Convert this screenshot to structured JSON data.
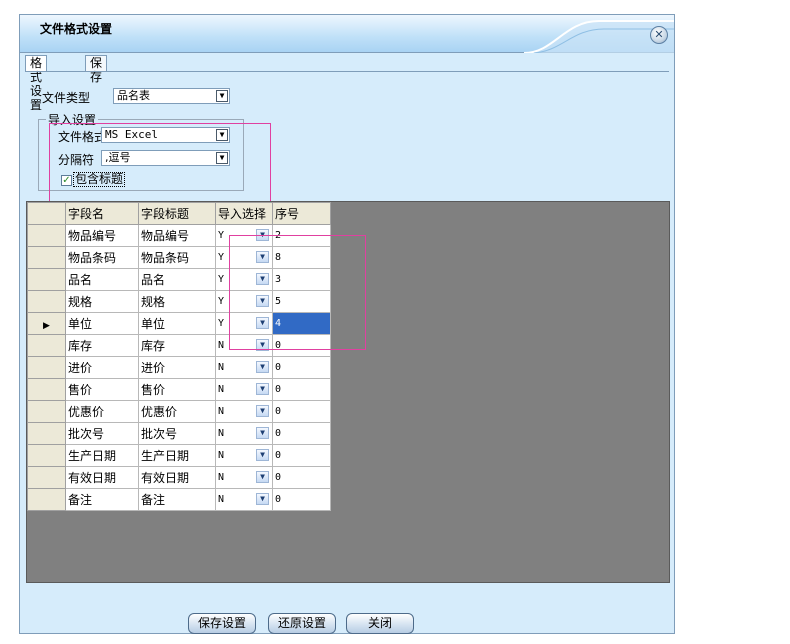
{
  "window": {
    "title": "文件格式设置"
  },
  "tabs": [
    {
      "label": "格式设置",
      "active": true
    },
    {
      "label": "保存",
      "active": false
    }
  ],
  "form": {
    "file_type_label": "文件类型",
    "file_type_value": "品名表",
    "import_group_legend": "导入设置",
    "file_format_label": "文件格式",
    "file_format_value": "MS Excel",
    "separator_label": "分隔符",
    "separator_value": ",逗号",
    "include_header_label": "包含标题",
    "include_header_checked": true
  },
  "grid": {
    "columns": [
      "字段名",
      "字段标题",
      "导入选择",
      "序号"
    ],
    "current_row_index": 4,
    "rows": [
      {
        "name": "物品编号",
        "title": "物品编号",
        "import": "Y",
        "seq": "2"
      },
      {
        "name": "物品条码",
        "title": "物品条码",
        "import": "Y",
        "seq": "8"
      },
      {
        "name": "品名",
        "title": "品名",
        "import": "Y",
        "seq": "3"
      },
      {
        "name": "规格",
        "title": "规格",
        "import": "Y",
        "seq": "5"
      },
      {
        "name": "单位",
        "title": "单位",
        "import": "Y",
        "seq": "4"
      },
      {
        "name": "库存",
        "title": "库存",
        "import": "N",
        "seq": "0"
      },
      {
        "name": "进价",
        "title": "进价",
        "import": "N",
        "seq": "0"
      },
      {
        "name": "售价",
        "title": "售价",
        "import": "N",
        "seq": "0"
      },
      {
        "name": "优惠价",
        "title": "优惠价",
        "import": "N",
        "seq": "0"
      },
      {
        "name": "批次号",
        "title": "批次号",
        "import": "N",
        "seq": "0"
      },
      {
        "name": "生产日期",
        "title": "生产日期",
        "import": "N",
        "seq": "0"
      },
      {
        "name": "有效日期",
        "title": "有效日期",
        "import": "N",
        "seq": "0"
      },
      {
        "name": "备注",
        "title": "备注",
        "import": "N",
        "seq": "0"
      }
    ]
  },
  "buttons": {
    "save": "保存设置",
    "restore": "还原设置",
    "close": "关闭"
  },
  "icons": {
    "close": "close-icon",
    "dropdown": "chevron-down-icon",
    "row_pointer": "triangle-right-icon",
    "check": "checkmark-icon"
  },
  "colors": {
    "window_bg": "#d6ecfb",
    "grid_bg": "#808080",
    "selection": "#316ac5",
    "highlight_box": "#e040a0"
  }
}
